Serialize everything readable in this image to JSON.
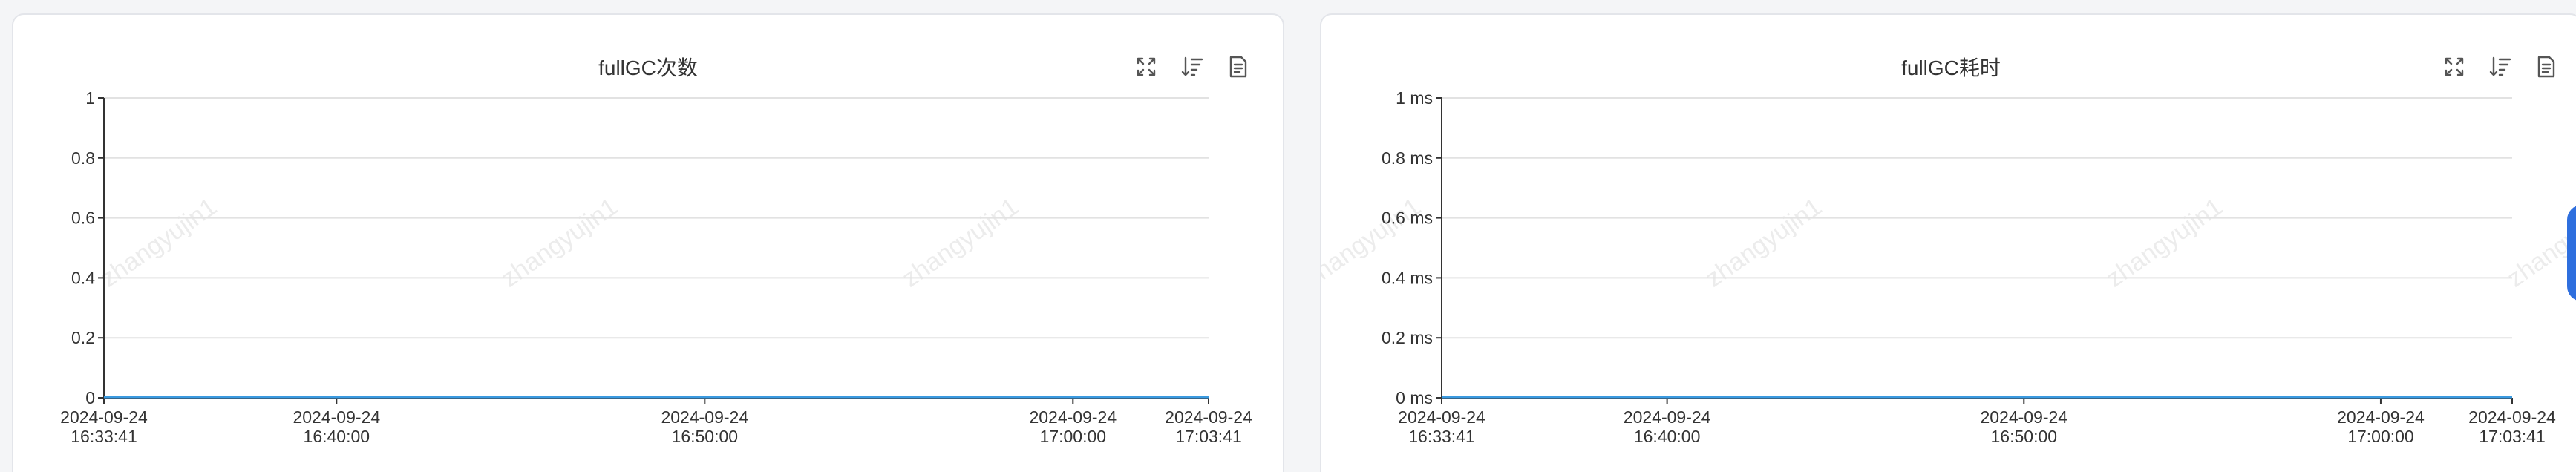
{
  "panels": [
    {
      "title": "fullGC次数",
      "toolbar": {
        "fullscreen_icon": "expand-icon",
        "sort_icon": "sort-icon",
        "export_icon": "document-icon"
      },
      "watermark": "zhangyujin1",
      "legend_color": "#3a9ae0"
    },
    {
      "title": "fullGC耗时",
      "toolbar": {
        "fullscreen_icon": "expand-icon",
        "sort_icon": "sort-icon",
        "export_icon": "document-icon"
      },
      "watermark": "zhangyujin1",
      "legend_color": "#3a9ae0"
    }
  ],
  "chart_data": [
    {
      "type": "line",
      "title": "fullGC次数",
      "x_ticks": [
        {
          "date": "2024-09-24",
          "time": "16:33:41",
          "t": 0
        },
        {
          "date": "2024-09-24",
          "time": "16:40:00",
          "t": 379
        },
        {
          "date": "2024-09-24",
          "time": "16:50:00",
          "t": 979
        },
        {
          "date": "2024-09-24",
          "time": "17:00:00",
          "t": 1579
        },
        {
          "date": "2024-09-24",
          "time": "17:03:41",
          "t": 1800
        }
      ],
      "y_ticks": [
        "0",
        "0.2",
        "0.4",
        "0.6",
        "0.8",
        "1"
      ],
      "ylim": [
        0,
        1
      ],
      "series": [
        {
          "values": [
            0,
            0,
            0,
            0,
            0
          ],
          "color": "#3a9ae0"
        }
      ],
      "grid": true
    },
    {
      "type": "line",
      "title": "fullGC耗时",
      "x_ticks": [
        {
          "date": "2024-09-24",
          "time": "16:33:41",
          "t": 0
        },
        {
          "date": "2024-09-24",
          "time": "16:40:00",
          "t": 379
        },
        {
          "date": "2024-09-24",
          "time": "16:50:00",
          "t": 979
        },
        {
          "date": "2024-09-24",
          "time": "17:00:00",
          "t": 1579
        },
        {
          "date": "2024-09-24",
          "time": "17:03:41",
          "t": 1800
        }
      ],
      "y_ticks": [
        "0 ms",
        "0.2 ms",
        "0.4 ms",
        "0.6 ms",
        "0.8 ms",
        "1 ms"
      ],
      "ylim": [
        0,
        1
      ],
      "series": [
        {
          "values": [
            0,
            0,
            0,
            0,
            0
          ],
          "color": "#3a9ae0"
        }
      ],
      "grid": true
    }
  ]
}
